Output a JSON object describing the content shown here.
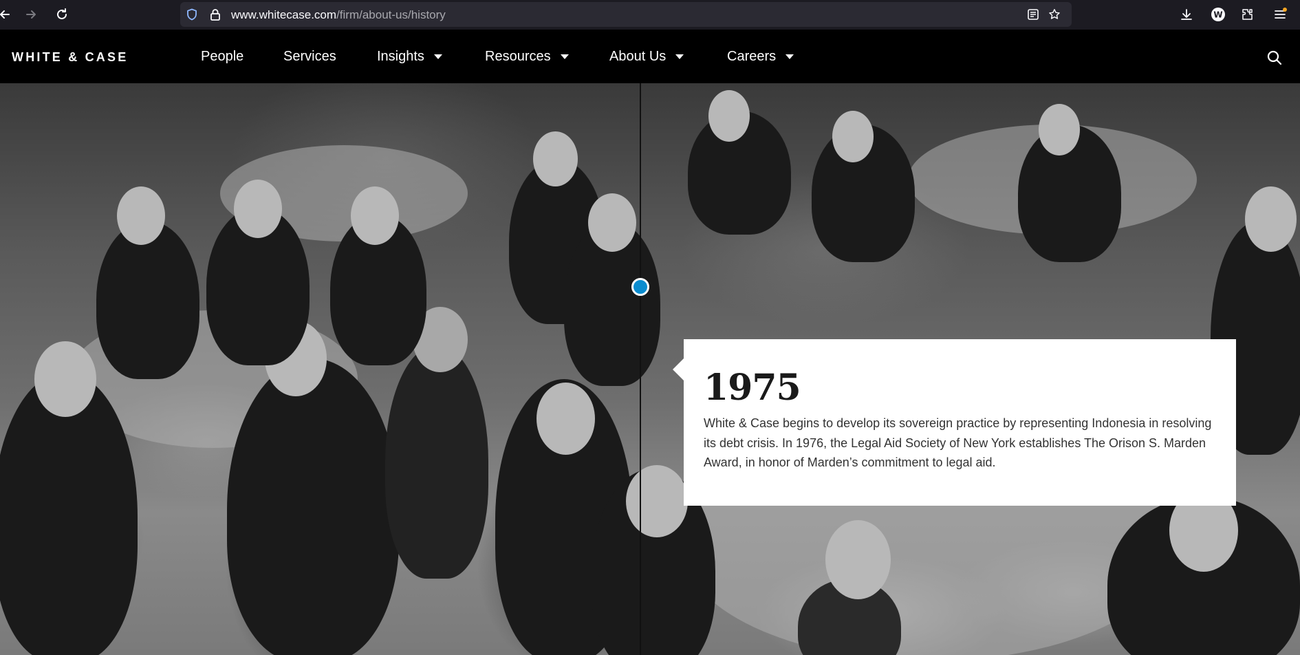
{
  "browser": {
    "url_host": "www.whitecase.com",
    "url_path": "/firm/about-us/history",
    "back_icon": "arrow-left-icon",
    "forward_icon": "arrow-right-icon",
    "reload_icon": "reload-icon"
  },
  "site": {
    "logo": "WHITE & CASE",
    "menu": [
      {
        "label": "People",
        "dropdown": false
      },
      {
        "label": "Services",
        "dropdown": false
      },
      {
        "label": "Insights",
        "dropdown": true
      },
      {
        "label": "Resources",
        "dropdown": true
      },
      {
        "label": "About Us",
        "dropdown": true
      },
      {
        "label": "Careers",
        "dropdown": true
      }
    ],
    "search_icon": "search-icon"
  },
  "timeline": {
    "year": "1975",
    "description": "White & Case begins to develop its sovereign practice by representing Indonesia in resolving its debt crisis. In 1976, the Legal Aid Society of New York establishes The Orison S. Marden Award, in honor of Marden’s commitment to legal aid.",
    "dot_color": "#0a8ccf"
  },
  "colors": {
    "header_bg": "#000000",
    "browser_bg": "#1c1b22",
    "urlbar_bg": "#2b2a33"
  }
}
